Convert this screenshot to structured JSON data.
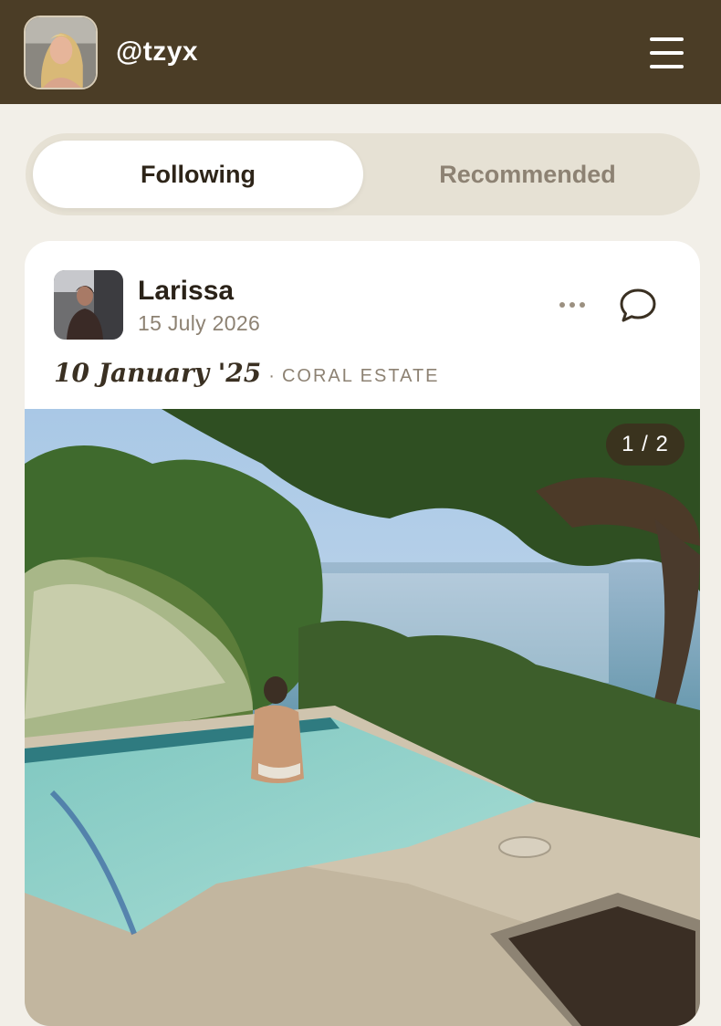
{
  "header": {
    "username": "@tzyx",
    "avatar_icon": "profile-avatar",
    "menu_icon": "hamburger-menu-icon",
    "background_color": "#4b3d26"
  },
  "feed_tabs": {
    "selected": "Following",
    "tabs": [
      {
        "label": "Following",
        "active": true
      },
      {
        "label": "Recommended",
        "active": false
      }
    ]
  },
  "post": {
    "author": "Larissa",
    "posted_date": "15 July 2026",
    "caption_date": "10 January '25",
    "separator": "·",
    "location": "CORAL ESTATE",
    "photo_counter": "1 / 2",
    "actions": {
      "more_icon": "more-dots-icon",
      "comment_icon": "comment-bubble-icon"
    }
  },
  "colors": {
    "background": "#f2efe8",
    "accent": "#4b3d26",
    "muted_text": "#8d8273"
  }
}
